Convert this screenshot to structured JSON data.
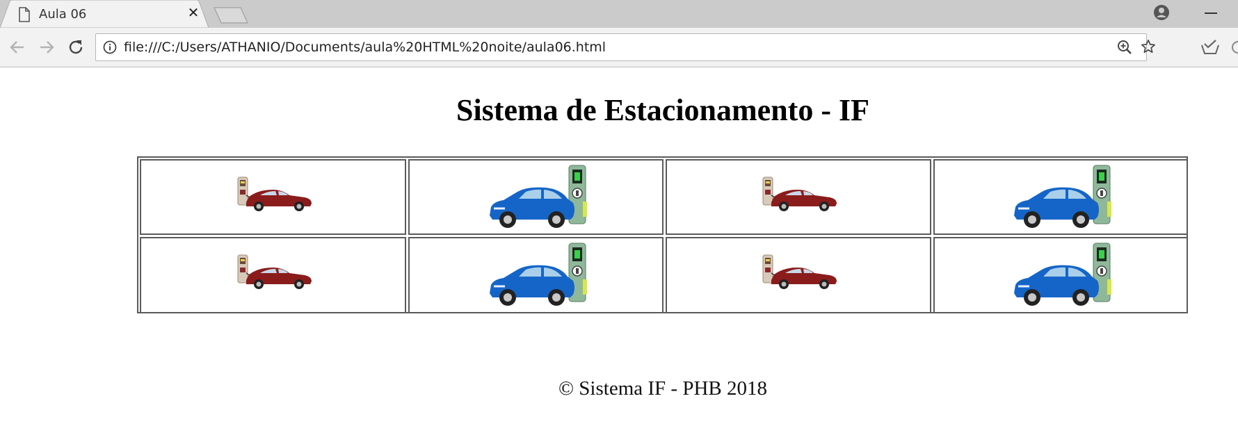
{
  "browser": {
    "tab_title": "Aula 06",
    "tab_close": "✕",
    "url": "file:///C:/Users/ATHANIO/Documents/aula%20HTML%20noite/aula06.html"
  },
  "page": {
    "title": "Sistema de Estacionamento - IF",
    "footer": "© Sistema IF - PHB 2018",
    "parking": {
      "rows": [
        [
          "red-car-charger",
          "blue-car-charger",
          "red-car-charger",
          "blue-car-charger"
        ],
        [
          "red-car-charger",
          "blue-car-charger",
          "red-car-charger",
          "blue-car-charger"
        ]
      ]
    }
  },
  "colors": {
    "red_car": "#8b1c1c",
    "blue_car": "#1565c8",
    "charger_green": "#8fb89a",
    "charger_beige": "#d8c9b8"
  }
}
